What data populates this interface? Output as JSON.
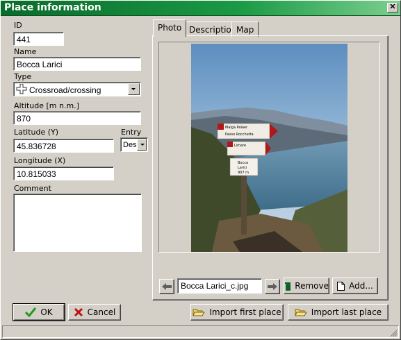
{
  "window": {
    "title": "Place information",
    "close_label": "✕"
  },
  "form": {
    "id_label": "ID",
    "id_value": "441",
    "name_label": "Name",
    "name_value": "Bocca Larici",
    "type_label": "Type",
    "type_value": "Crossroad/crossing",
    "altitude_label": "Altitude [m n.m.]",
    "altitude_value": "870",
    "latitude_label": "Latitude (Y)",
    "latitude_value": "45.836728",
    "entry_label": "Entry",
    "entry_value": "Des.",
    "longitude_label": "Longitude (X)",
    "longitude_value": "10.815033",
    "comment_label": "Comment",
    "comment_value": ""
  },
  "tabs": [
    {
      "label": "Photo"
    },
    {
      "label": "Descriptions"
    },
    {
      "label": "Map"
    }
  ],
  "photo": {
    "filename": "Bocca Larici_c.jpg",
    "remove_label": "Remove",
    "add_label": "Add...",
    "sign_lines": [
      "Malga Palaer",
      "Passo Rocchetta",
      "Limare",
      "Bocca",
      "Larici",
      "907 m"
    ]
  },
  "buttons": {
    "ok_label": "OK",
    "cancel_label": "Cancel",
    "import_first_label": "Import first place",
    "import_last_label": "Import last place"
  },
  "colors": {
    "titlebar": "#0a6b2c",
    "ok_check": "#1f9a1f",
    "cancel_x": "#c01010",
    "sign_red": "#b01818"
  }
}
